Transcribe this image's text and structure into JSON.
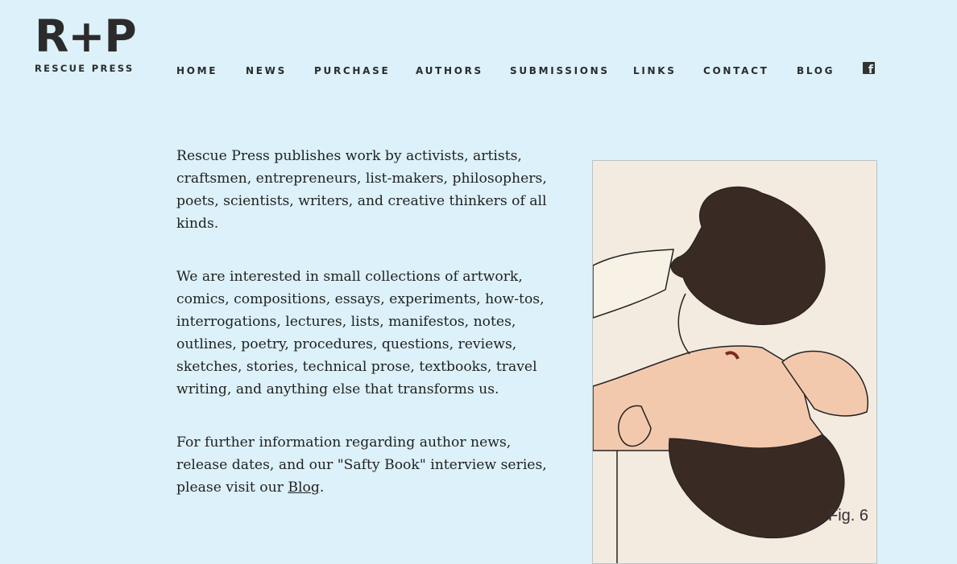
{
  "brand": {
    "mark": "R+P",
    "name": "RESCUE PRESS"
  },
  "nav": {
    "items": [
      "HOME",
      "NEWS",
      "PURCHASE",
      "AUTHORS",
      "SUBMISSIONS",
      "LINKS",
      "CONTACT",
      "BLOG"
    ],
    "social_icon": "facebook-icon"
  },
  "content": {
    "para1": "Rescue Press publishes work by activists, artists, craftsmen, entrepreneurs, list-makers, philosophers, poets, scientists, writers, and creative thinkers of all kinds.",
    "para2": "We are interested in small collections of artwork, comics, compositions, essays, experiments, how-tos, interrogations, lectures, lists, manifestos, notes, outlines, poetry, procedures, questions, reviews, sketches, stories, technical prose, textbooks, travel writing, and anything else that transforms us.",
    "para3_before": "For further information regarding author news, release dates, and our \"Safty Book\" interview series, please visit our ",
    "para3_link": "Blog",
    "para3_after": "."
  },
  "figure": {
    "label": "Fig. 6"
  },
  "colors": {
    "background": "#dcf1f9",
    "text": "#222222",
    "skin": "#f3c9ad",
    "hair": "#3a2a24"
  }
}
